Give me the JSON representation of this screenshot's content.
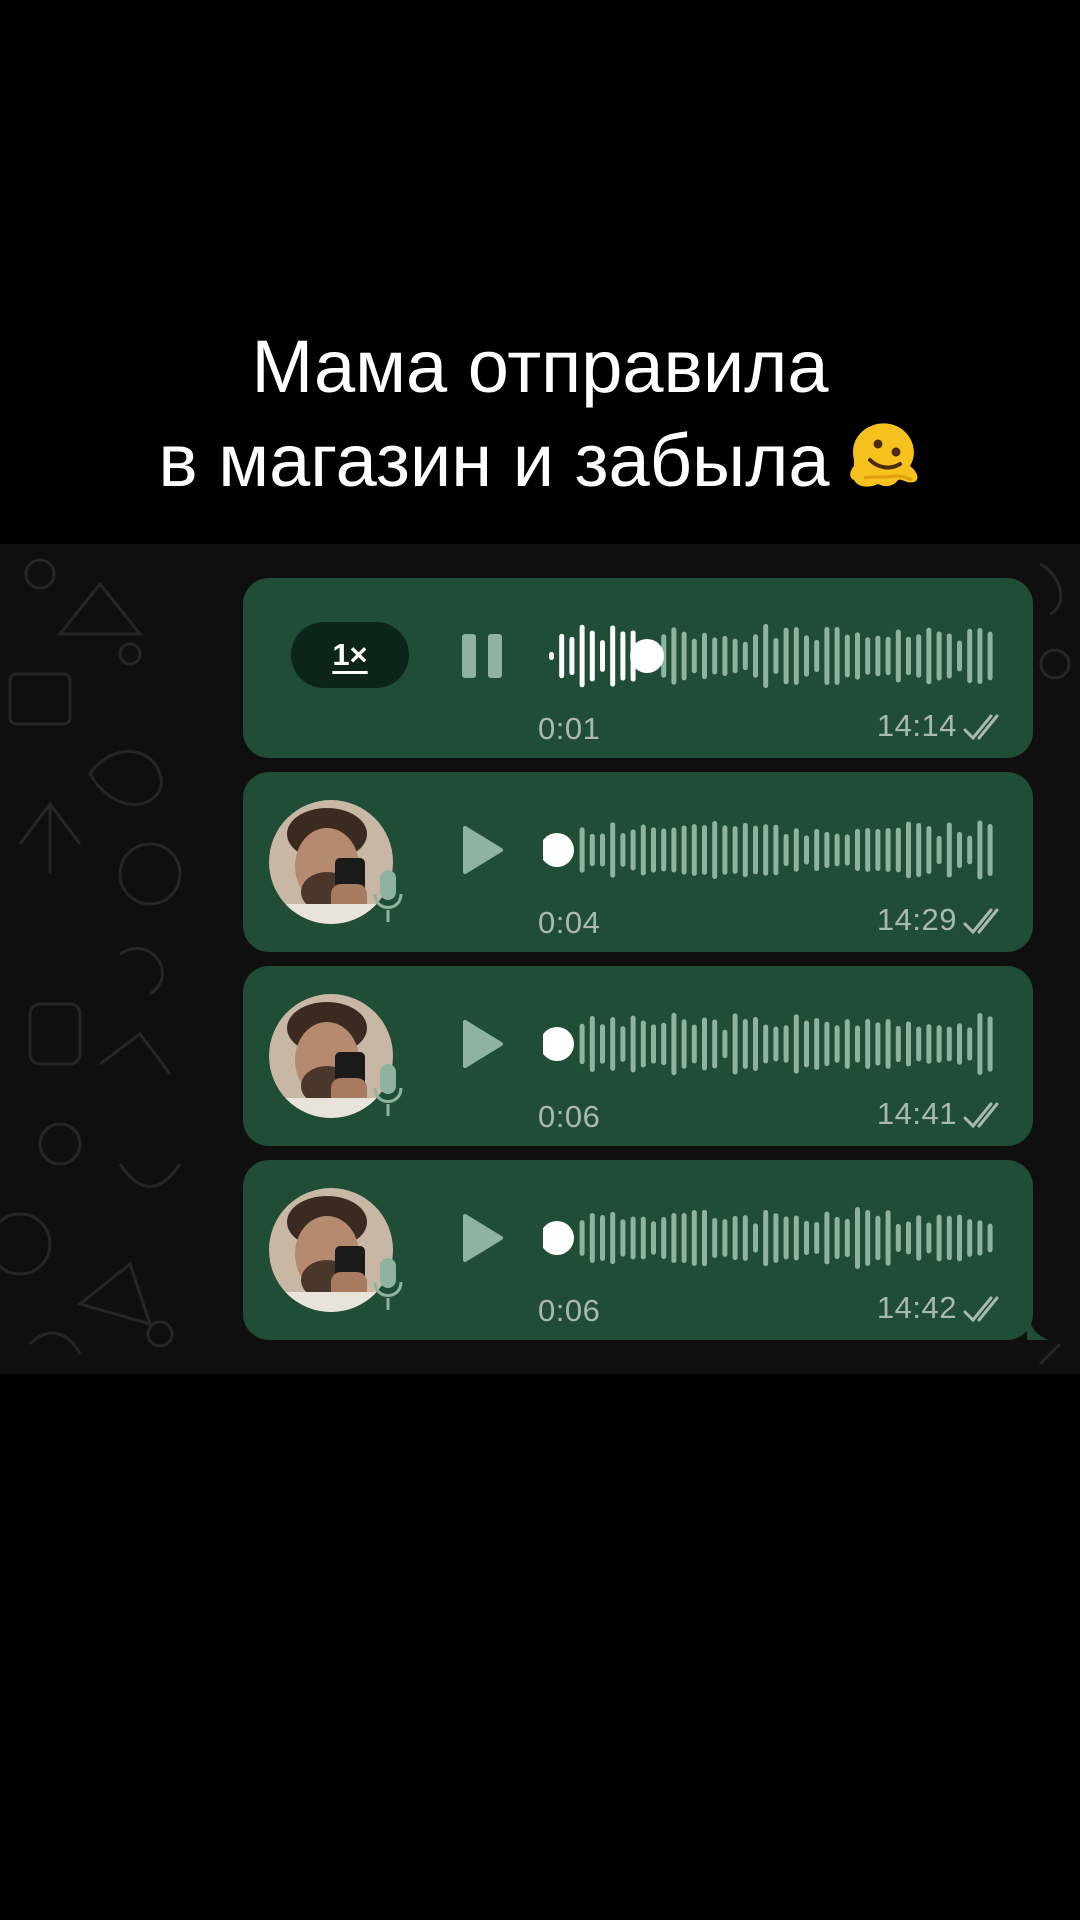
{
  "caption": {
    "line1": "Мама отправила",
    "line2": "в магазин и забыла",
    "emoji": "melting-face"
  },
  "colors": {
    "bubble": "#1f4d35",
    "chat_background": "#0f0f0f",
    "speed_pill": "#0d2519",
    "wave_played": "#ffffff",
    "wave_unplayed": "#8fb39e",
    "meta_text": "#aab9b0"
  },
  "messages": [
    {
      "speed_label": "1×",
      "state": "playing",
      "control_icon": "pause-icon",
      "progress": 0.2,
      "duration": "0:01",
      "time": "14:14",
      "status": "read"
    },
    {
      "state": "paused",
      "control_icon": "play-icon",
      "progress": 0.0,
      "duration": "0:04",
      "time": "14:29",
      "status": "read",
      "avatar": true
    },
    {
      "state": "paused",
      "control_icon": "play-icon",
      "progress": 0.0,
      "duration": "0:06",
      "time": "14:41",
      "status": "read",
      "avatar": true
    },
    {
      "state": "paused",
      "control_icon": "play-icon",
      "progress": 0.0,
      "duration": "0:06",
      "time": "14:42",
      "status": "read",
      "avatar": true
    }
  ]
}
